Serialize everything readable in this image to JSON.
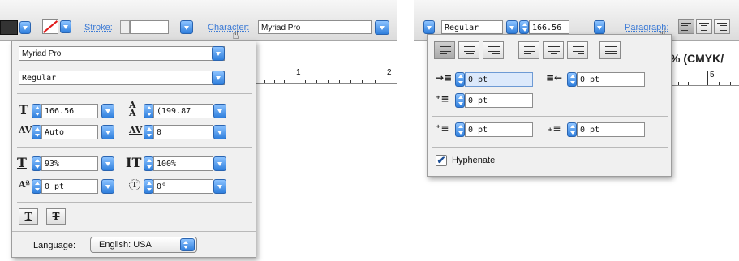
{
  "left": {
    "toolbar": {
      "stroke_label": "Stroke:",
      "character_label": "Character:",
      "font_value": "Myriad Pro"
    },
    "character_panel": {
      "font_family": "Myriad Pro",
      "font_style": "Regular",
      "font_size": "166.56",
      "leading": "(199.87",
      "kerning": "Auto",
      "tracking": "0",
      "vertical_scale": "93%",
      "horizontal_scale": "100%",
      "baseline_shift": "0 pt",
      "rotation": "0°",
      "underline_glyph": "T",
      "strikethrough_glyph": "T",
      "language_label": "Language:",
      "language_value": "English: USA"
    },
    "ruler_labels": [
      "1",
      "2"
    ]
  },
  "right": {
    "toolbar": {
      "font_style": "Regular",
      "font_size": "166.56",
      "paragraph_label": "Paragraph:"
    },
    "paragraph_panel": {
      "left_indent": "0 pt",
      "right_indent": "0 pt",
      "first_line_indent": "0 pt",
      "space_before": "0 pt",
      "space_after": "0 pt",
      "hyphenate_label": "Hyphenate",
      "hyphenate_checked": true
    },
    "doc_title_fragment": "% (CMYK/",
    "ruler_label": "5"
  },
  "colors": {
    "accent": "#2f7fdd",
    "link": "#3b7ad6",
    "panel_bg": "#f0f0f0"
  },
  "icons": [
    "fill-swatch-icon",
    "stroke-swatch-icon",
    "font-size-icon",
    "leading-icon",
    "kerning-icon",
    "tracking-icon",
    "vertical-scale-icon",
    "horizontal-scale-icon",
    "baseline-shift-icon",
    "rotation-icon",
    "underline-icon",
    "strikethrough-icon",
    "align-left-icon",
    "align-center-icon",
    "align-right-icon",
    "justify-left-icon",
    "justify-center-icon",
    "justify-right-icon",
    "justify-all-icon",
    "left-indent-icon",
    "right-indent-icon",
    "first-line-indent-icon",
    "space-before-icon",
    "space-after-icon",
    "hand-cursor-icon"
  ]
}
